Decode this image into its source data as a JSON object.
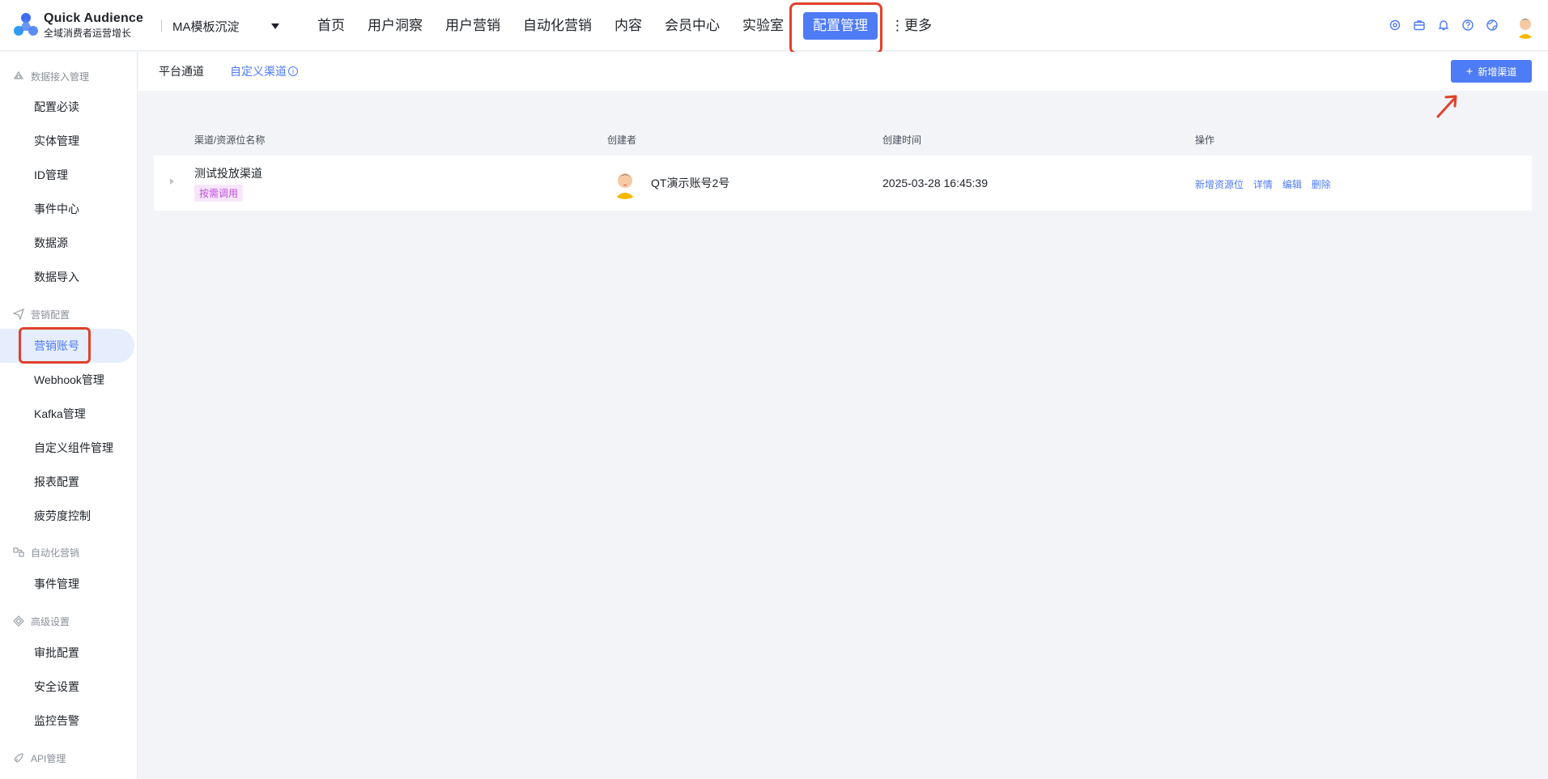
{
  "brand": {
    "name": "Quick Audience",
    "subtitle": "全域消费者运营增长"
  },
  "workspace": {
    "label": "MA模板沉淀"
  },
  "nav": {
    "items": [
      "首页",
      "用户洞察",
      "用户营销",
      "自动化营销",
      "内容",
      "会员中心",
      "实验室"
    ],
    "active": "配置管理",
    "more": "⋮更多"
  },
  "header_icons": [
    "settings-icon",
    "briefcase-icon",
    "bell-icon",
    "help-icon",
    "globe-icon"
  ],
  "sidebar": {
    "groups": [
      {
        "label": "数据接入管理",
        "icon": "cloud-icon",
        "items": [
          "配置必读",
          "实体管理",
          "ID管理",
          "事件中心",
          "数据源",
          "数据导入"
        ]
      },
      {
        "label": "营销配置",
        "icon": "send-icon",
        "items": [
          "营销账号",
          "Webhook管理",
          "Kafka管理",
          "自定义组件管理",
          "报表配置",
          "疲劳度控制"
        ]
      },
      {
        "label": "自动化营销",
        "icon": "flow-icon",
        "items": [
          "事件管理"
        ]
      },
      {
        "label": "高级设置",
        "icon": "diamond-icon",
        "items": [
          "审批配置",
          "安全设置",
          "监控告警"
        ]
      },
      {
        "label": "API管理",
        "icon": "rocket-icon",
        "items": []
      }
    ],
    "active_item": "营销账号"
  },
  "subtabs": {
    "platform": "平台通道",
    "custom": "自定义渠道",
    "info_glyph": "i"
  },
  "add_button": {
    "label": "新增渠道",
    "plus": "+"
  },
  "table": {
    "headers": {
      "name": "渠道/资源位名称",
      "creator": "创建者",
      "created_at": "创建时间",
      "ops": "操作"
    },
    "rows": [
      {
        "name": "测试投放渠道",
        "tag": "按需调用",
        "creator": "QT演示账号2号",
        "created_at": "2025-03-28 16:45:39",
        "ops": [
          "新增资源位",
          "详情",
          "编辑",
          "删除"
        ]
      }
    ]
  },
  "colors": {
    "accent": "#4e7bf6",
    "highlight": "#e0412c",
    "tag_text": "#c04fd6",
    "tag_bg": "#f7e6fb"
  }
}
